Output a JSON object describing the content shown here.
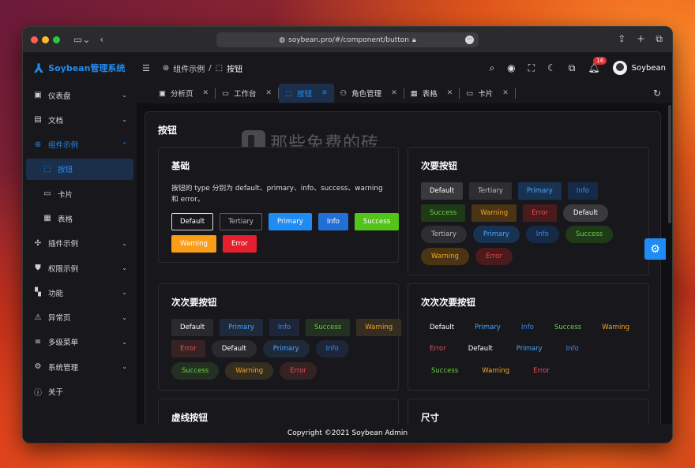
{
  "browser": {
    "url": "soybean.pro/#/component/button"
  },
  "app": {
    "name": "Soybean管理系统",
    "accent": "#1f8cf5"
  },
  "breadcrumb": {
    "parent": "组件示例",
    "current": "按钮"
  },
  "header": {
    "notification_count": "16",
    "user_name": "Soybean"
  },
  "sidebar": {
    "items": [
      {
        "label": "仪表盘",
        "icon": "dashboard-icon"
      },
      {
        "label": "文档",
        "icon": "document-icon"
      },
      {
        "label": "组件示例",
        "icon": "component-icon"
      },
      {
        "label": "按钮",
        "icon": "cursor-click-icon"
      },
      {
        "label": "卡片",
        "icon": "card-icon"
      },
      {
        "label": "表格",
        "icon": "table-icon"
      },
      {
        "label": "插件示例",
        "icon": "plugin-icon"
      },
      {
        "label": "权限示例",
        "icon": "shield-icon"
      },
      {
        "label": "功能",
        "icon": "grid-icon"
      },
      {
        "label": "异常页",
        "icon": "exception-icon"
      },
      {
        "label": "多级菜单",
        "icon": "menu-list-icon"
      },
      {
        "label": "系统管理",
        "icon": "system-settings-icon"
      },
      {
        "label": "关于",
        "icon": "info-icon"
      }
    ]
  },
  "tabs": [
    {
      "label": "分析页"
    },
    {
      "label": "工作台"
    },
    {
      "label": "按钮"
    },
    {
      "label": "角色管理"
    },
    {
      "label": "表格"
    },
    {
      "label": "卡片"
    }
  ],
  "page": {
    "title": "按钮",
    "watermark": "那些免费的砖"
  },
  "sections": {
    "basic": {
      "title": "基础",
      "desc": "按钮的 type 分别为 default、primary、info、success、warning 和 error。",
      "buttons": [
        "Default",
        "Tertiary",
        "Primary",
        "Info",
        "Success",
        "Warning",
        "Error"
      ]
    },
    "secondary": {
      "title": "次要按钮",
      "row1": [
        "Default",
        "Tertiary",
        "Primary",
        "Info"
      ],
      "row2": [
        "Success",
        "Warning",
        "Error",
        "Default"
      ],
      "row3": [
        "Tertiary",
        "Primary",
        "Info",
        "Success"
      ],
      "row4": [
        "Warning",
        "Error"
      ]
    },
    "tertiary": {
      "title": "次次要按钮",
      "row1": [
        "Default",
        "Primary",
        "Info",
        "Success",
        "Warning"
      ],
      "row2": [
        "Error",
        "Default",
        "Primary",
        "Info"
      ],
      "row3": [
        "Success",
        "Warning",
        "Error"
      ]
    },
    "quaternary": {
      "title": "次次次要按钮",
      "row1": [
        "Default",
        "Primary",
        "Info",
        "Success",
        "Warning"
      ],
      "row2": [
        "Error",
        "Default",
        "Primary",
        "Info"
      ],
      "row3": [
        "Success",
        "Warning",
        "Error"
      ]
    },
    "dashed": {
      "title": "虚线按钮"
    },
    "size": {
      "title": "尺寸"
    }
  },
  "footer": {
    "text": "Copyright ©2021 Soybean Admin"
  }
}
